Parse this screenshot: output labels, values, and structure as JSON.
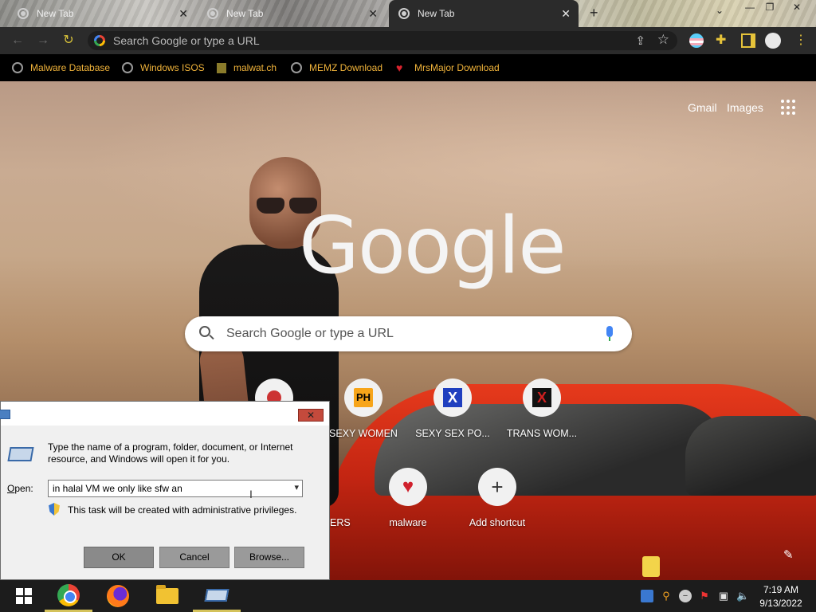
{
  "browser": {
    "tabs": [
      {
        "title": "New Tab",
        "active": false
      },
      {
        "title": "New Tab",
        "active": false
      },
      {
        "title": "New Tab",
        "active": true
      }
    ],
    "new_tab_symbol": "+",
    "tab_close_symbol": "✕",
    "tab_search_symbol": "⌄",
    "window_controls": {
      "minimize": "—",
      "maximize": "❐",
      "close": "✕"
    },
    "omnibox": {
      "placeholder": "Search Google or type a URL"
    },
    "toolbar_icons": [
      "back-icon",
      "forward-icon",
      "reload-icon",
      "share-icon",
      "star-icon",
      "profile-flag-icon",
      "extensions-icon",
      "sidepanel-icon",
      "avatar-icon",
      "menu-icon"
    ],
    "bookmarks": [
      {
        "label": "Malware Database",
        "icon": "globe-icon"
      },
      {
        "label": "Windows ISOS",
        "icon": "globe-icon"
      },
      {
        "label": "malwat.ch",
        "icon": "plant-icon"
      },
      {
        "label": "MEMZ Download",
        "icon": "globe-icon"
      },
      {
        "label": "MrsMajor Download",
        "icon": "heart-icon"
      }
    ],
    "bookmark_color": "#f0b33a"
  },
  "ntp": {
    "gmail": "Gmail",
    "images": "Images",
    "logo": "Google",
    "search_placeholder": "Search Google or type a URL",
    "shortcuts_row1": [
      {
        "label": "SEXY WOMEN",
        "badge": "PH"
      },
      {
        "label": "SEXY SEX PO...",
        "badge": "X"
      },
      {
        "label": "TRANS WOM...",
        "badge": "X"
      }
    ],
    "shortcuts_row2": [
      {
        "label": "ERS"
      },
      {
        "label": "malware"
      },
      {
        "label": "Add shortcut",
        "badge": "+"
      }
    ]
  },
  "run_dialog": {
    "close": "✕",
    "description": "Type the name of a program, folder, document, or Internet resource, and Windows will open it for you.",
    "open_label_prefix": "O",
    "open_label_rest": "pen:",
    "input_value": "in halal VM we only like sfw an",
    "admin_note": "This task will be created with administrative privileges.",
    "buttons": {
      "ok": "OK",
      "cancel": "Cancel",
      "browse": "Browse..."
    }
  },
  "taskbar": {
    "time": "7:19 AM",
    "date": "9/13/2022"
  }
}
